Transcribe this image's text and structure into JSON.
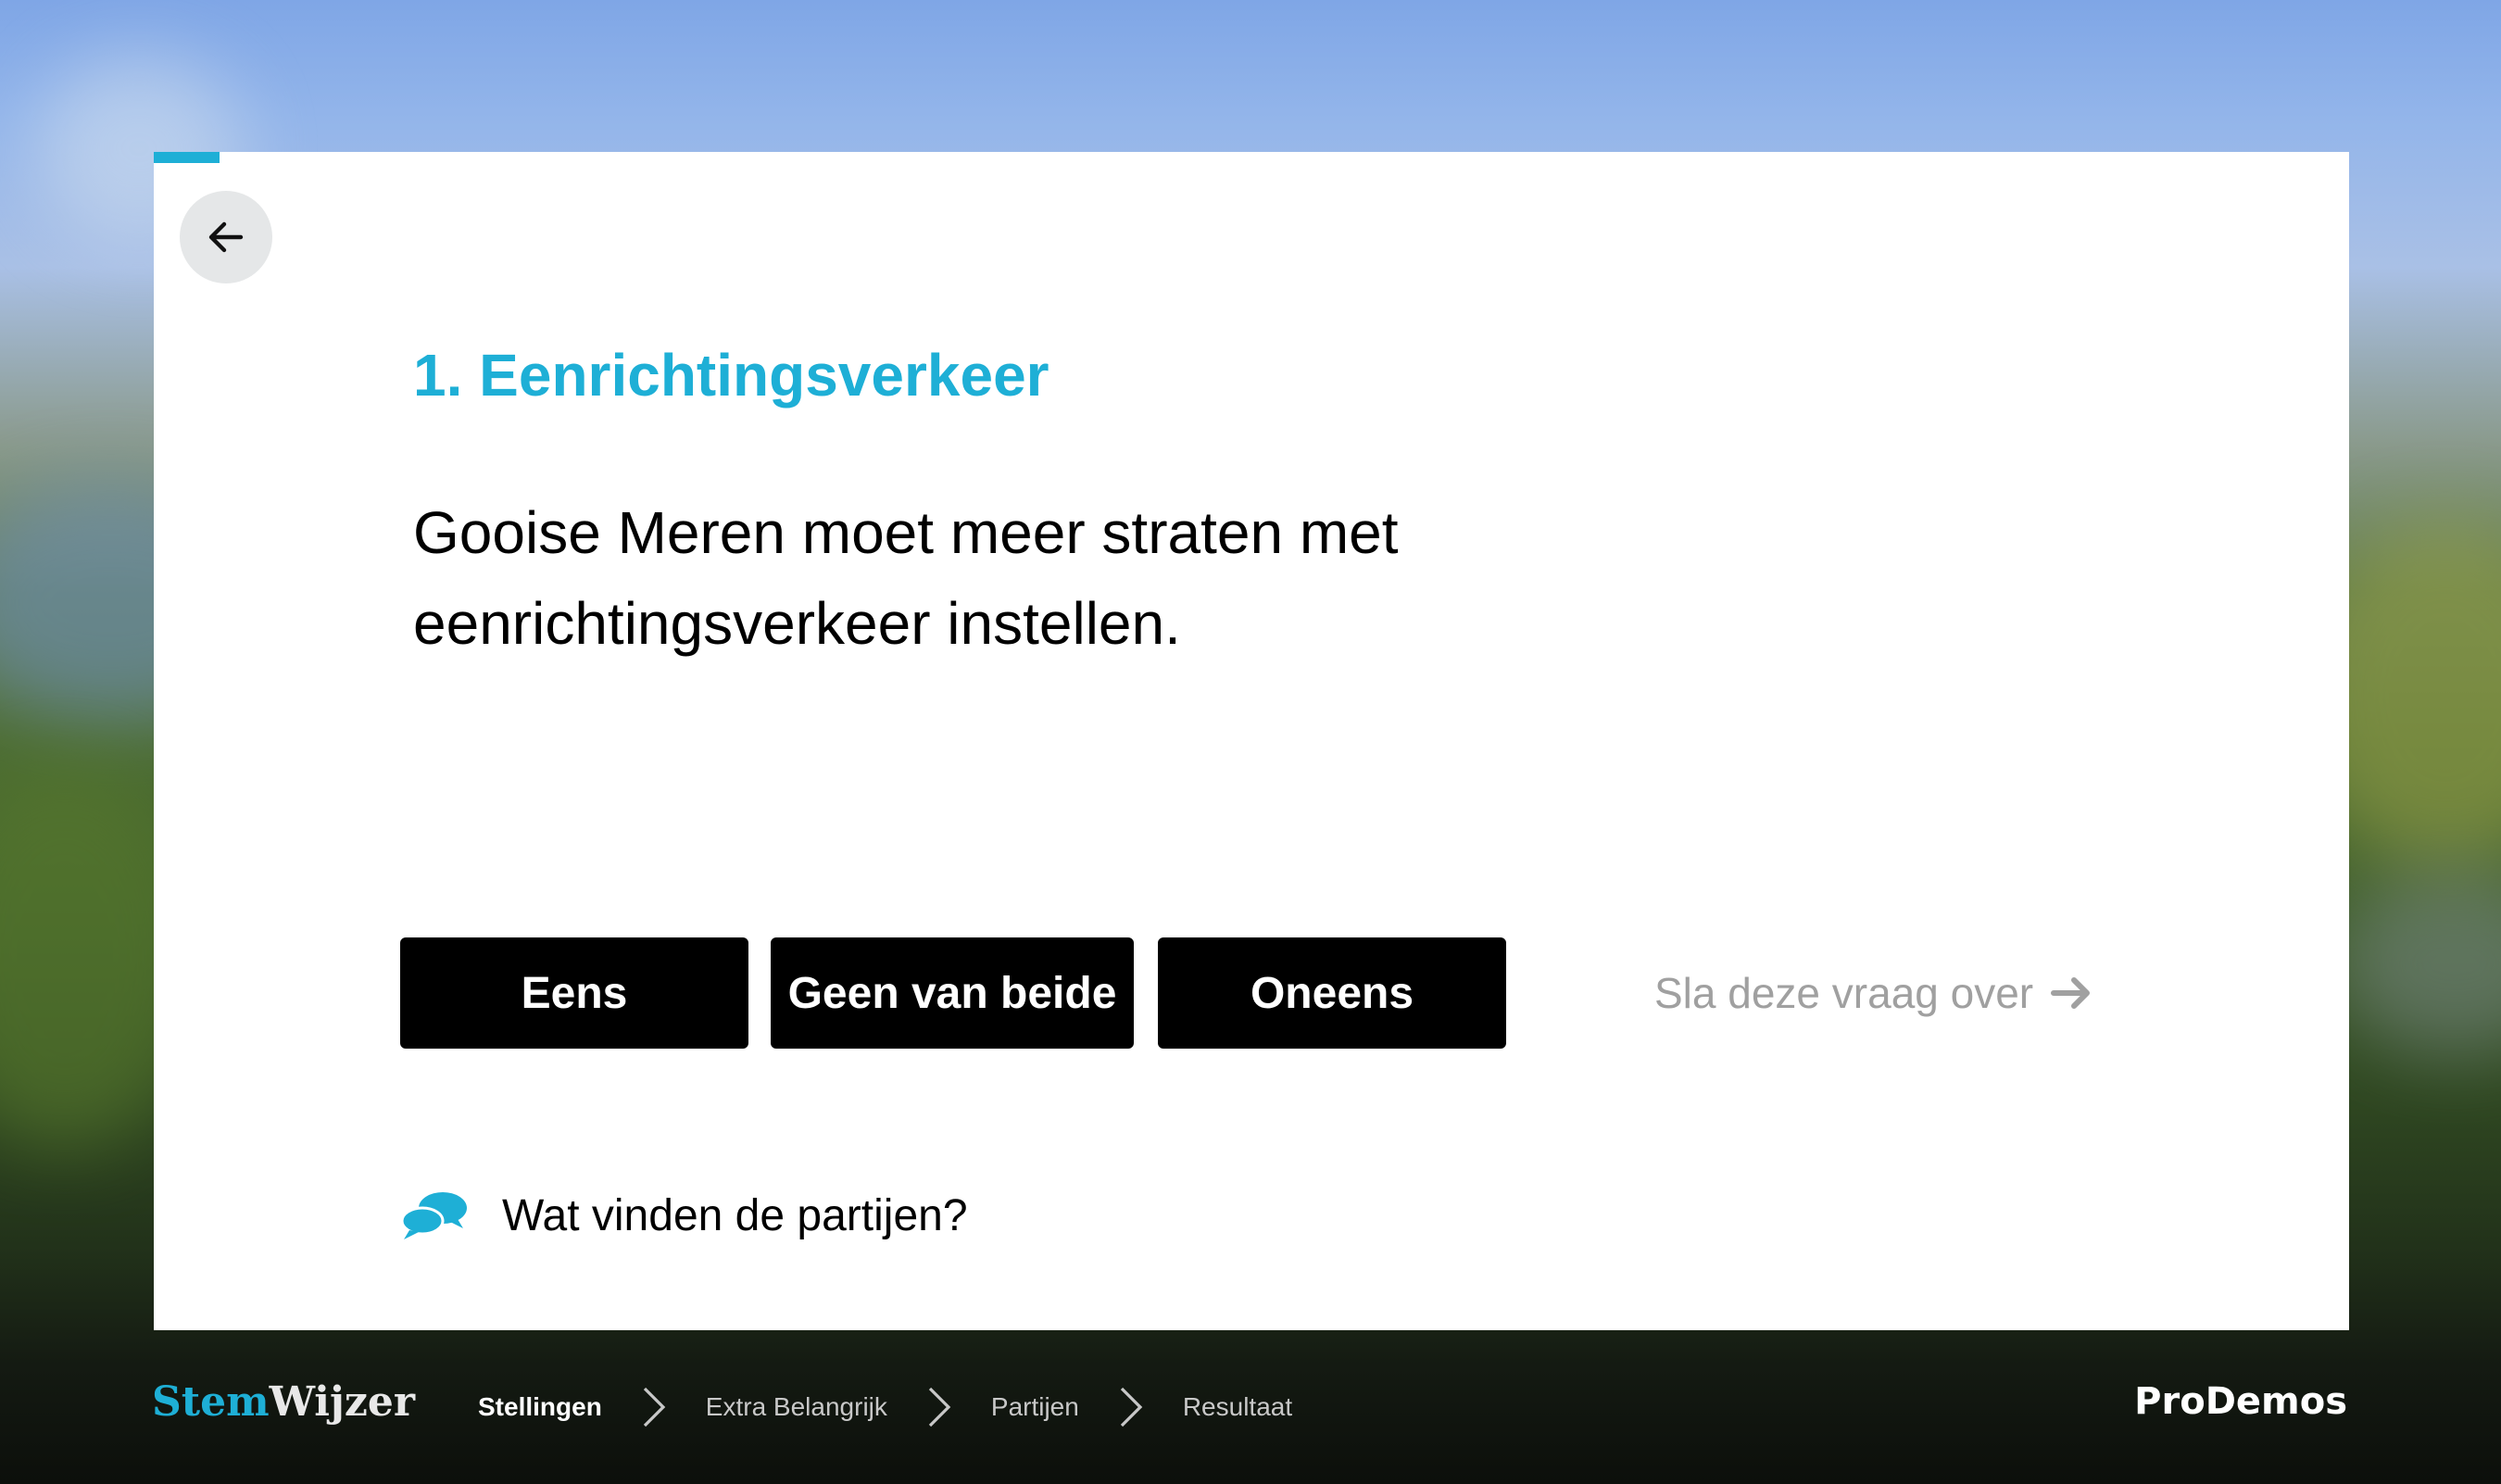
{
  "progress": {
    "fraction": 0.03
  },
  "back_button": {
    "icon": "arrow-left-icon"
  },
  "statement": {
    "title": "1. Eenrichtingsverkeer",
    "text": "Gooise Meren moet meer straten met eenrichtingsverkeer instellen."
  },
  "answers": {
    "agree": "Eens",
    "neither": "Geen van beide",
    "disagree": "Oneens"
  },
  "skip": {
    "label": "Sla deze vraag over",
    "icon": "arrow-right-icon"
  },
  "parties": {
    "label": "Wat vinden de partijen?",
    "icon": "chat-bubbles-icon"
  },
  "footer": {
    "logo_stem": "Stem",
    "logo_wijzer": "Wijzer",
    "steps": [
      "Stellingen",
      "Extra Belangrijk",
      "Partijen",
      "Resultaat"
    ],
    "active_step": "Stellingen",
    "brand": "ProDemos"
  },
  "colors": {
    "accent": "#1eafd6",
    "button_bg": "#000000",
    "button_text": "#ffffff",
    "skip_text": "#a0a0a0"
  }
}
